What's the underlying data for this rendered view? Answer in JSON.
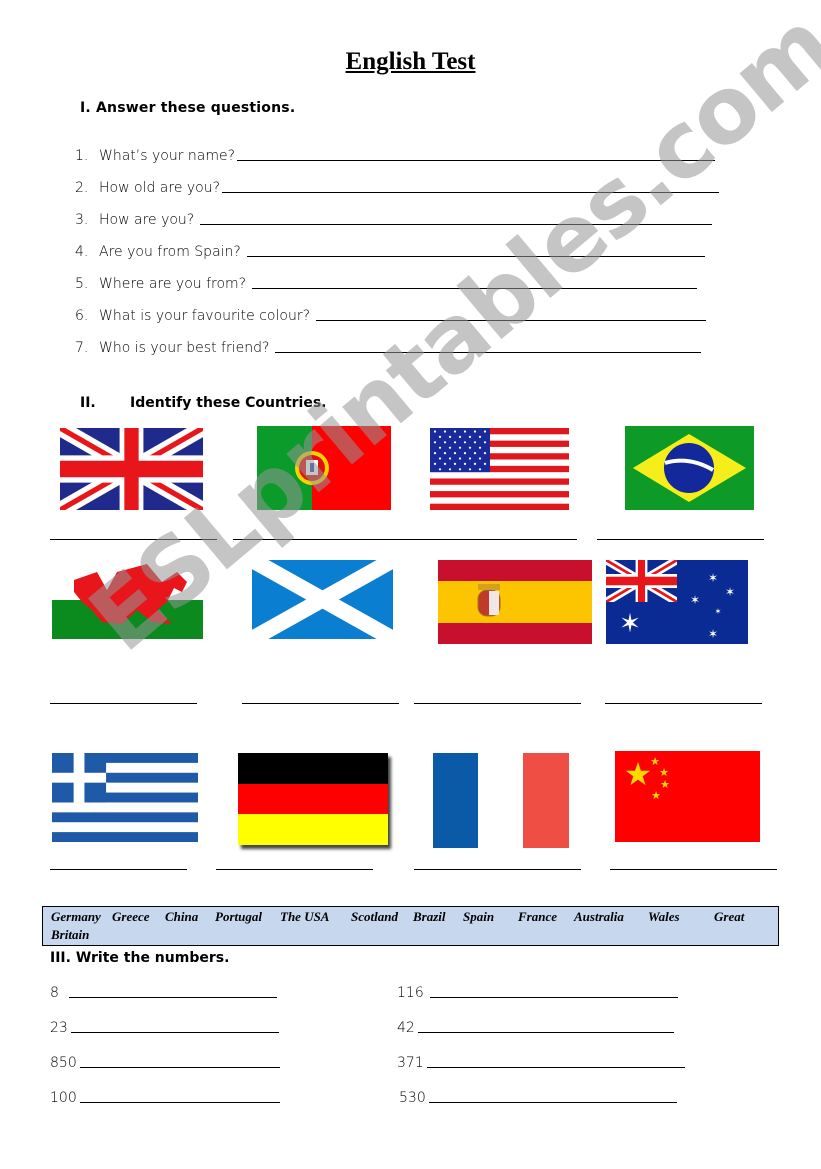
{
  "document": {
    "title": "English Test",
    "watermark": "ESLprintables.com"
  },
  "section1": {
    "heading": "I. Answer these questions.",
    "questions": [
      {
        "num": "1.",
        "text": "What’s your name?"
      },
      {
        "num": "2.",
        "text": "How old are you?"
      },
      {
        "num": "3.",
        "text": "How are you?"
      },
      {
        "num": "4.",
        "text": "Are you from Spain?"
      },
      {
        "num": "5.",
        "text": "Where are you from?"
      },
      {
        "num": "6.",
        "text": "What is your favourite colour?"
      },
      {
        "num": "7.",
        "text": "Who is your best friend?"
      }
    ]
  },
  "section2": {
    "roman": "II.",
    "heading": "Identify these Countries.",
    "flags": [
      {
        "icon": "flag-great-britain-icon"
      },
      {
        "icon": "flag-portugal-icon"
      },
      {
        "icon": "flag-usa-icon"
      },
      {
        "icon": "flag-brazil-icon"
      },
      {
        "icon": "flag-wales-icon"
      },
      {
        "icon": "flag-scotland-icon"
      },
      {
        "icon": "flag-spain-icon"
      },
      {
        "icon": "flag-australia-icon"
      },
      {
        "icon": "flag-greece-icon"
      },
      {
        "icon": "flag-germany-icon"
      },
      {
        "icon": "flag-france-icon"
      },
      {
        "icon": "flag-china-icon"
      }
    ],
    "word_bank": [
      "Germany",
      "Greece",
      "China",
      "Portugal",
      "The USA",
      "Scotland",
      "Brazil",
      "Spain",
      "France",
      "Australia",
      "Wales",
      "Great",
      "Britain"
    ],
    "word_bank_bg": "#c6d7ee"
  },
  "section3": {
    "heading": "III. Write the numbers.",
    "left": [
      "8",
      "23",
      "850",
      "100"
    ],
    "right": [
      "116",
      "42",
      "371",
      "530"
    ]
  }
}
